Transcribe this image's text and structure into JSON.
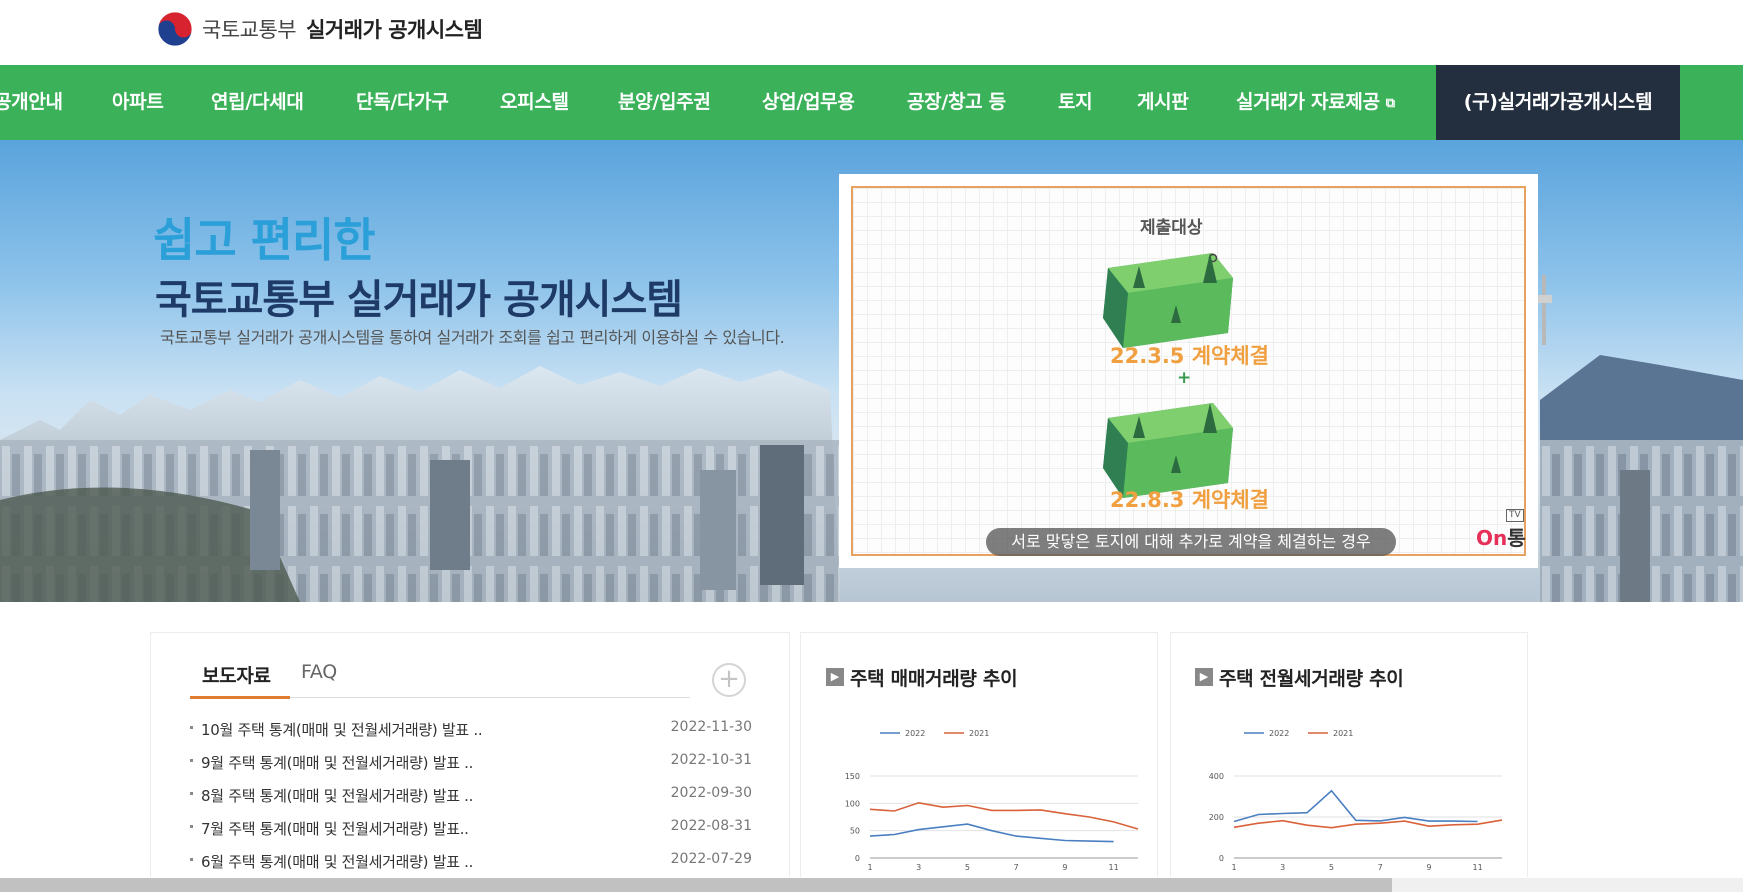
{
  "header": {
    "ministry": "국토교통부",
    "system_name": "실거래가 공개시스템"
  },
  "nav": {
    "items": [
      {
        "label": "공개안내"
      },
      {
        "label": "아파트"
      },
      {
        "label": "연립/다세대"
      },
      {
        "label": "단독/다가구"
      },
      {
        "label": "오피스텔"
      },
      {
        "label": "분양/입주권"
      },
      {
        "label": "상업/업무용"
      },
      {
        "label": "공장/창고 등"
      },
      {
        "label": "토지"
      },
      {
        "label": "게시판"
      },
      {
        "label": "실거래가 자료제공"
      }
    ],
    "external_icon": "external-link-icon",
    "old_system": "(구)실거래가공개시스템",
    "old_system_color": "#232f3e",
    "bar_color": "#3bb15a"
  },
  "hero": {
    "slogan": "쉽고 편리한",
    "title": "국토교통부 실거래가 공개시스템",
    "description": "국토교통부 실거래가 공개시스템을 통하여 실거래가 조회를 쉽고 편리하게 이용하실 수 있습니다."
  },
  "video": {
    "label": "제출대상",
    "date1": "22.3.5 계약체결",
    "plus": "+",
    "date2": "22.8.3 계약체결",
    "caption": "서로 맞닿은 토지에 대해 추가로 계약을 체결하는 경우",
    "brand_on": "On",
    "brand_tong": "통",
    "brand_tv": "TV"
  },
  "news": {
    "tabs": [
      {
        "label": "보도자료"
      },
      {
        "label": "FAQ"
      }
    ],
    "more_icon": "plus-circle-icon",
    "more_label": "+",
    "items": [
      {
        "title": "10월 주택 통계(매매 및 전월세거래량) 발표 ..",
        "date": "2022-11-30"
      },
      {
        "title": "9월 주택 통계(매매 및 전월세거래량) 발표 ..",
        "date": "2022-10-31"
      },
      {
        "title": "8월 주택 통계(매매 및 전월세거래량) 발표 ..",
        "date": "2022-09-30"
      },
      {
        "title": "7월 주택 통계(매매 및 전월세거래량) 발표..",
        "date": "2022-08-31"
      },
      {
        "title": "6월 주택 통계(매매 및 전월세거래량) 발표 ..",
        "date": "2022-07-29"
      }
    ]
  },
  "panels": {
    "sale_title": "주택 매매거래량 추이",
    "rent_title": "주택 전월세거래량 추이",
    "arrow_icon": "arrow-right-icon",
    "arrow_glyph": "▶"
  },
  "chart_data": [
    {
      "type": "line",
      "title": "주택 매매거래량 추이",
      "x": [
        1,
        2,
        3,
        4,
        5,
        6,
        7,
        8,
        9,
        10,
        11,
        12
      ],
      "x_ticks": [
        "1",
        "3",
        "5",
        "7",
        "9",
        "11"
      ],
      "y_ticks": [
        "0",
        "50",
        "100",
        "150"
      ],
      "ylim": [
        0,
        150
      ],
      "legend_position": "top-left",
      "grid": true,
      "series": [
        {
          "name": "2022",
          "color": "#4a7fc1",
          "values": [
            40,
            43,
            52,
            57,
            62,
            50,
            40,
            36,
            32,
            31,
            30
          ]
        },
        {
          "name": "2021",
          "color": "#d9623b",
          "values": [
            89,
            86,
            101,
            93,
            96,
            87,
            87,
            88,
            81,
            75,
            66,
            53
          ]
        }
      ]
    },
    {
      "type": "line",
      "title": "주택 전월세거래량 추이",
      "x": [
        1,
        2,
        3,
        4,
        5,
        6,
        7,
        8,
        9,
        10,
        11,
        12
      ],
      "x_ticks": [
        "1",
        "3",
        "5",
        "7",
        "9",
        "11"
      ],
      "y_ticks": [
        "0",
        "200",
        "400"
      ],
      "ylim": [
        0,
        400
      ],
      "legend_position": "top-left",
      "grid": true,
      "series": [
        {
          "name": "2022",
          "color": "#4a7fc1",
          "values": [
            178,
            212,
            217,
            221,
            328,
            184,
            181,
            198,
            180,
            180,
            178
          ]
        },
        {
          "name": "2021",
          "color": "#d9623b",
          "values": [
            150,
            170,
            182,
            160,
            148,
            165,
            170,
            180,
            155,
            162,
            165,
            185
          ]
        }
      ]
    }
  ]
}
